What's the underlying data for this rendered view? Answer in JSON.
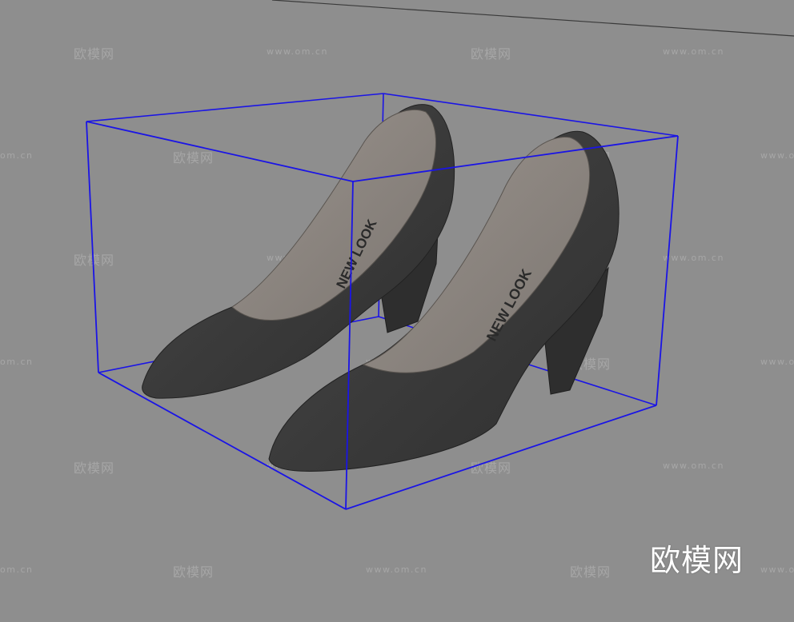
{
  "scene": {
    "background_color": "#8e8e8e",
    "bounding_box_color": "#1a14e6",
    "shoe_color": "#3a3a3a",
    "insole_color": "#8a8480",
    "insole_brand": "NEW LOOK"
  },
  "watermark": {
    "logo_text": "欧模网",
    "url_text": "www.om.cn",
    "url_text_short": "om.cn"
  },
  "brand_watermark": "欧模网"
}
